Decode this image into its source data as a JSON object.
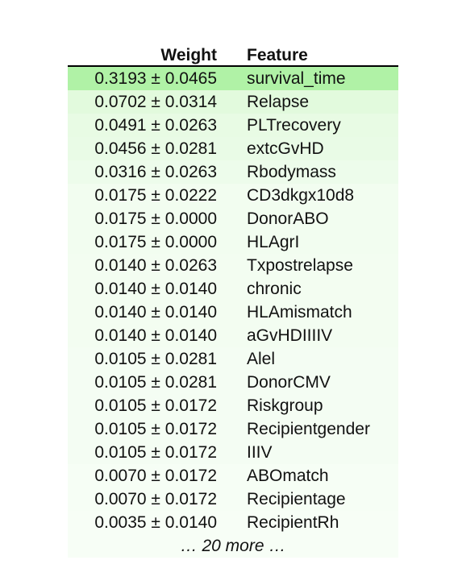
{
  "table": {
    "headers": {
      "weight": "Weight",
      "feature": "Feature"
    },
    "rows": [
      {
        "weight": "0.3193 ± 0.0465",
        "feature": "survival_time",
        "bg": "#b0f2a6"
      },
      {
        "weight": "0.0702 ± 0.0314",
        "feature": "Relapse",
        "bg": "#e2fadd"
      },
      {
        "weight": "0.0491 ± 0.0263",
        "feature": "PLTrecovery",
        "bg": "#e8fbe4"
      },
      {
        "weight": "0.0456 ± 0.0281",
        "feature": "extcGvHD",
        "bg": "#e9fbe6"
      },
      {
        "weight": "0.0316 ± 0.0263",
        "feature": "Rbodymass",
        "bg": "#edfceb"
      },
      {
        "weight": "0.0175 ± 0.0222",
        "feature": "CD3dkgx10d8",
        "bg": "#f2fdf0"
      },
      {
        "weight": "0.0175 ± 0.0000",
        "feature": "DonorABO",
        "bg": "#f2fdf0"
      },
      {
        "weight": "0.0175 ± 0.0000",
        "feature": "HLAgrI",
        "bg": "#f2fdf0"
      },
      {
        "weight": "0.0140 ± 0.0263",
        "feature": "Txpostrelapse",
        "bg": "#f3fdf1"
      },
      {
        "weight": "0.0140 ± 0.0140",
        "feature": "chronic",
        "bg": "#f3fdf1"
      },
      {
        "weight": "0.0140 ± 0.0140",
        "feature": "HLAmismatch",
        "bg": "#f3fdf1"
      },
      {
        "weight": "0.0140 ± 0.0140",
        "feature": "aGvHDIIIIV",
        "bg": "#f3fdf1"
      },
      {
        "weight": "0.0105 ± 0.0281",
        "feature": "Alel",
        "bg": "#f4fdf3"
      },
      {
        "weight": "0.0105 ± 0.0281",
        "feature": "DonorCMV",
        "bg": "#f4fdf3"
      },
      {
        "weight": "0.0105 ± 0.0172",
        "feature": "Riskgroup",
        "bg": "#f4fdf3"
      },
      {
        "weight": "0.0105 ± 0.0172",
        "feature": "Recipientgender",
        "bg": "#f4fdf3"
      },
      {
        "weight": "0.0105 ± 0.0172",
        "feature": "IIIV",
        "bg": "#f4fdf3"
      },
      {
        "weight": "0.0070 ± 0.0172",
        "feature": "ABOmatch",
        "bg": "#f6fef5"
      },
      {
        "weight": "0.0070 ± 0.0172",
        "feature": "Recipientage",
        "bg": "#f6fef5"
      },
      {
        "weight": "0.0035 ± 0.0140",
        "feature": "RecipientRh",
        "bg": "#f7fef6"
      }
    ],
    "more_label": "… 20 more …",
    "more_bg": "#f7fef6"
  }
}
